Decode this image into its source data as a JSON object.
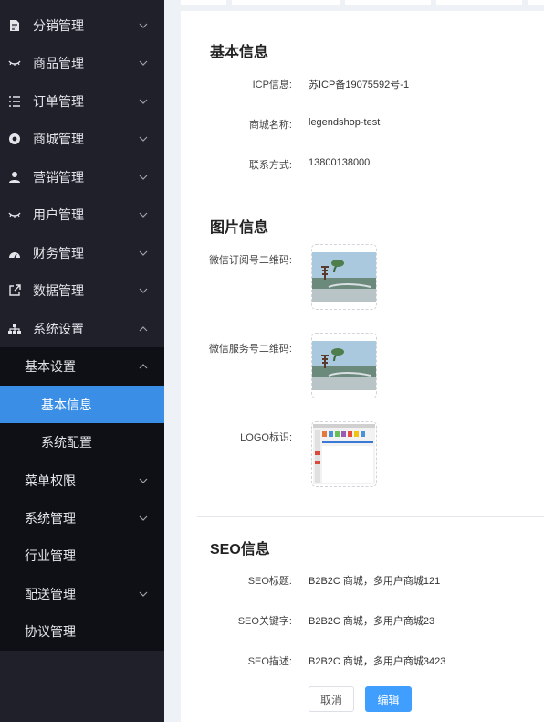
{
  "sidebar": {
    "items": [
      {
        "label": "分销管理",
        "icon": "document-edit-icon"
      },
      {
        "label": "商品管理",
        "icon": "eye-closed-icon"
      },
      {
        "label": "订单管理",
        "icon": "list-icon"
      },
      {
        "label": "商城管理",
        "icon": "compass-icon"
      },
      {
        "label": "营销管理",
        "icon": "user-icon"
      },
      {
        "label": "用户管理",
        "icon": "eye-closed-icon"
      },
      {
        "label": "财务管理",
        "icon": "dashboard-icon"
      },
      {
        "label": "数据管理",
        "icon": "external-link-icon"
      },
      {
        "label": "系统设置",
        "icon": "sitemap-icon"
      }
    ],
    "submenu": {
      "basic_settings": "基本设置",
      "basic_info": "基本信息",
      "system_config": "系统配置",
      "menu_permission": "菜单权限",
      "system_management": "系统管理",
      "industry_management": "行业管理",
      "delivery_management": "配送管理",
      "agreement_management": "协议管理"
    }
  },
  "basic": {
    "title": "基本信息",
    "icp_label": "ICP信息:",
    "icp_value": "苏ICP备19075592号-1",
    "shop_name_label": "商城名称:",
    "shop_name_value": "legendshop-test",
    "contact_label": "联系方式:",
    "contact_value": "13800138000"
  },
  "images": {
    "title": "图片信息",
    "wechat_sub_label": "微信订阅号二维码:",
    "wechat_service_label": "微信服务号二维码:",
    "logo_label": "LOGO标识:"
  },
  "seo": {
    "title": "SEO信息",
    "seo_title_label": "SEO标题:",
    "seo_title_value": "B2B2C 商城，多用户商城121",
    "seo_keywords_label": "SEO关键字:",
    "seo_keywords_value": "B2B2C 商城，多用户商城23",
    "seo_desc_label": "SEO描述:",
    "seo_desc_value": "B2B2C 商城，多用户商城3423"
  },
  "actions": {
    "cancel": "取消",
    "edit": "编辑"
  },
  "colors": {
    "sidebar_bg": "#1f2029",
    "submenu_bg": "#0f1015",
    "active": "#3a8ee6",
    "primary_button": "#409eff"
  }
}
